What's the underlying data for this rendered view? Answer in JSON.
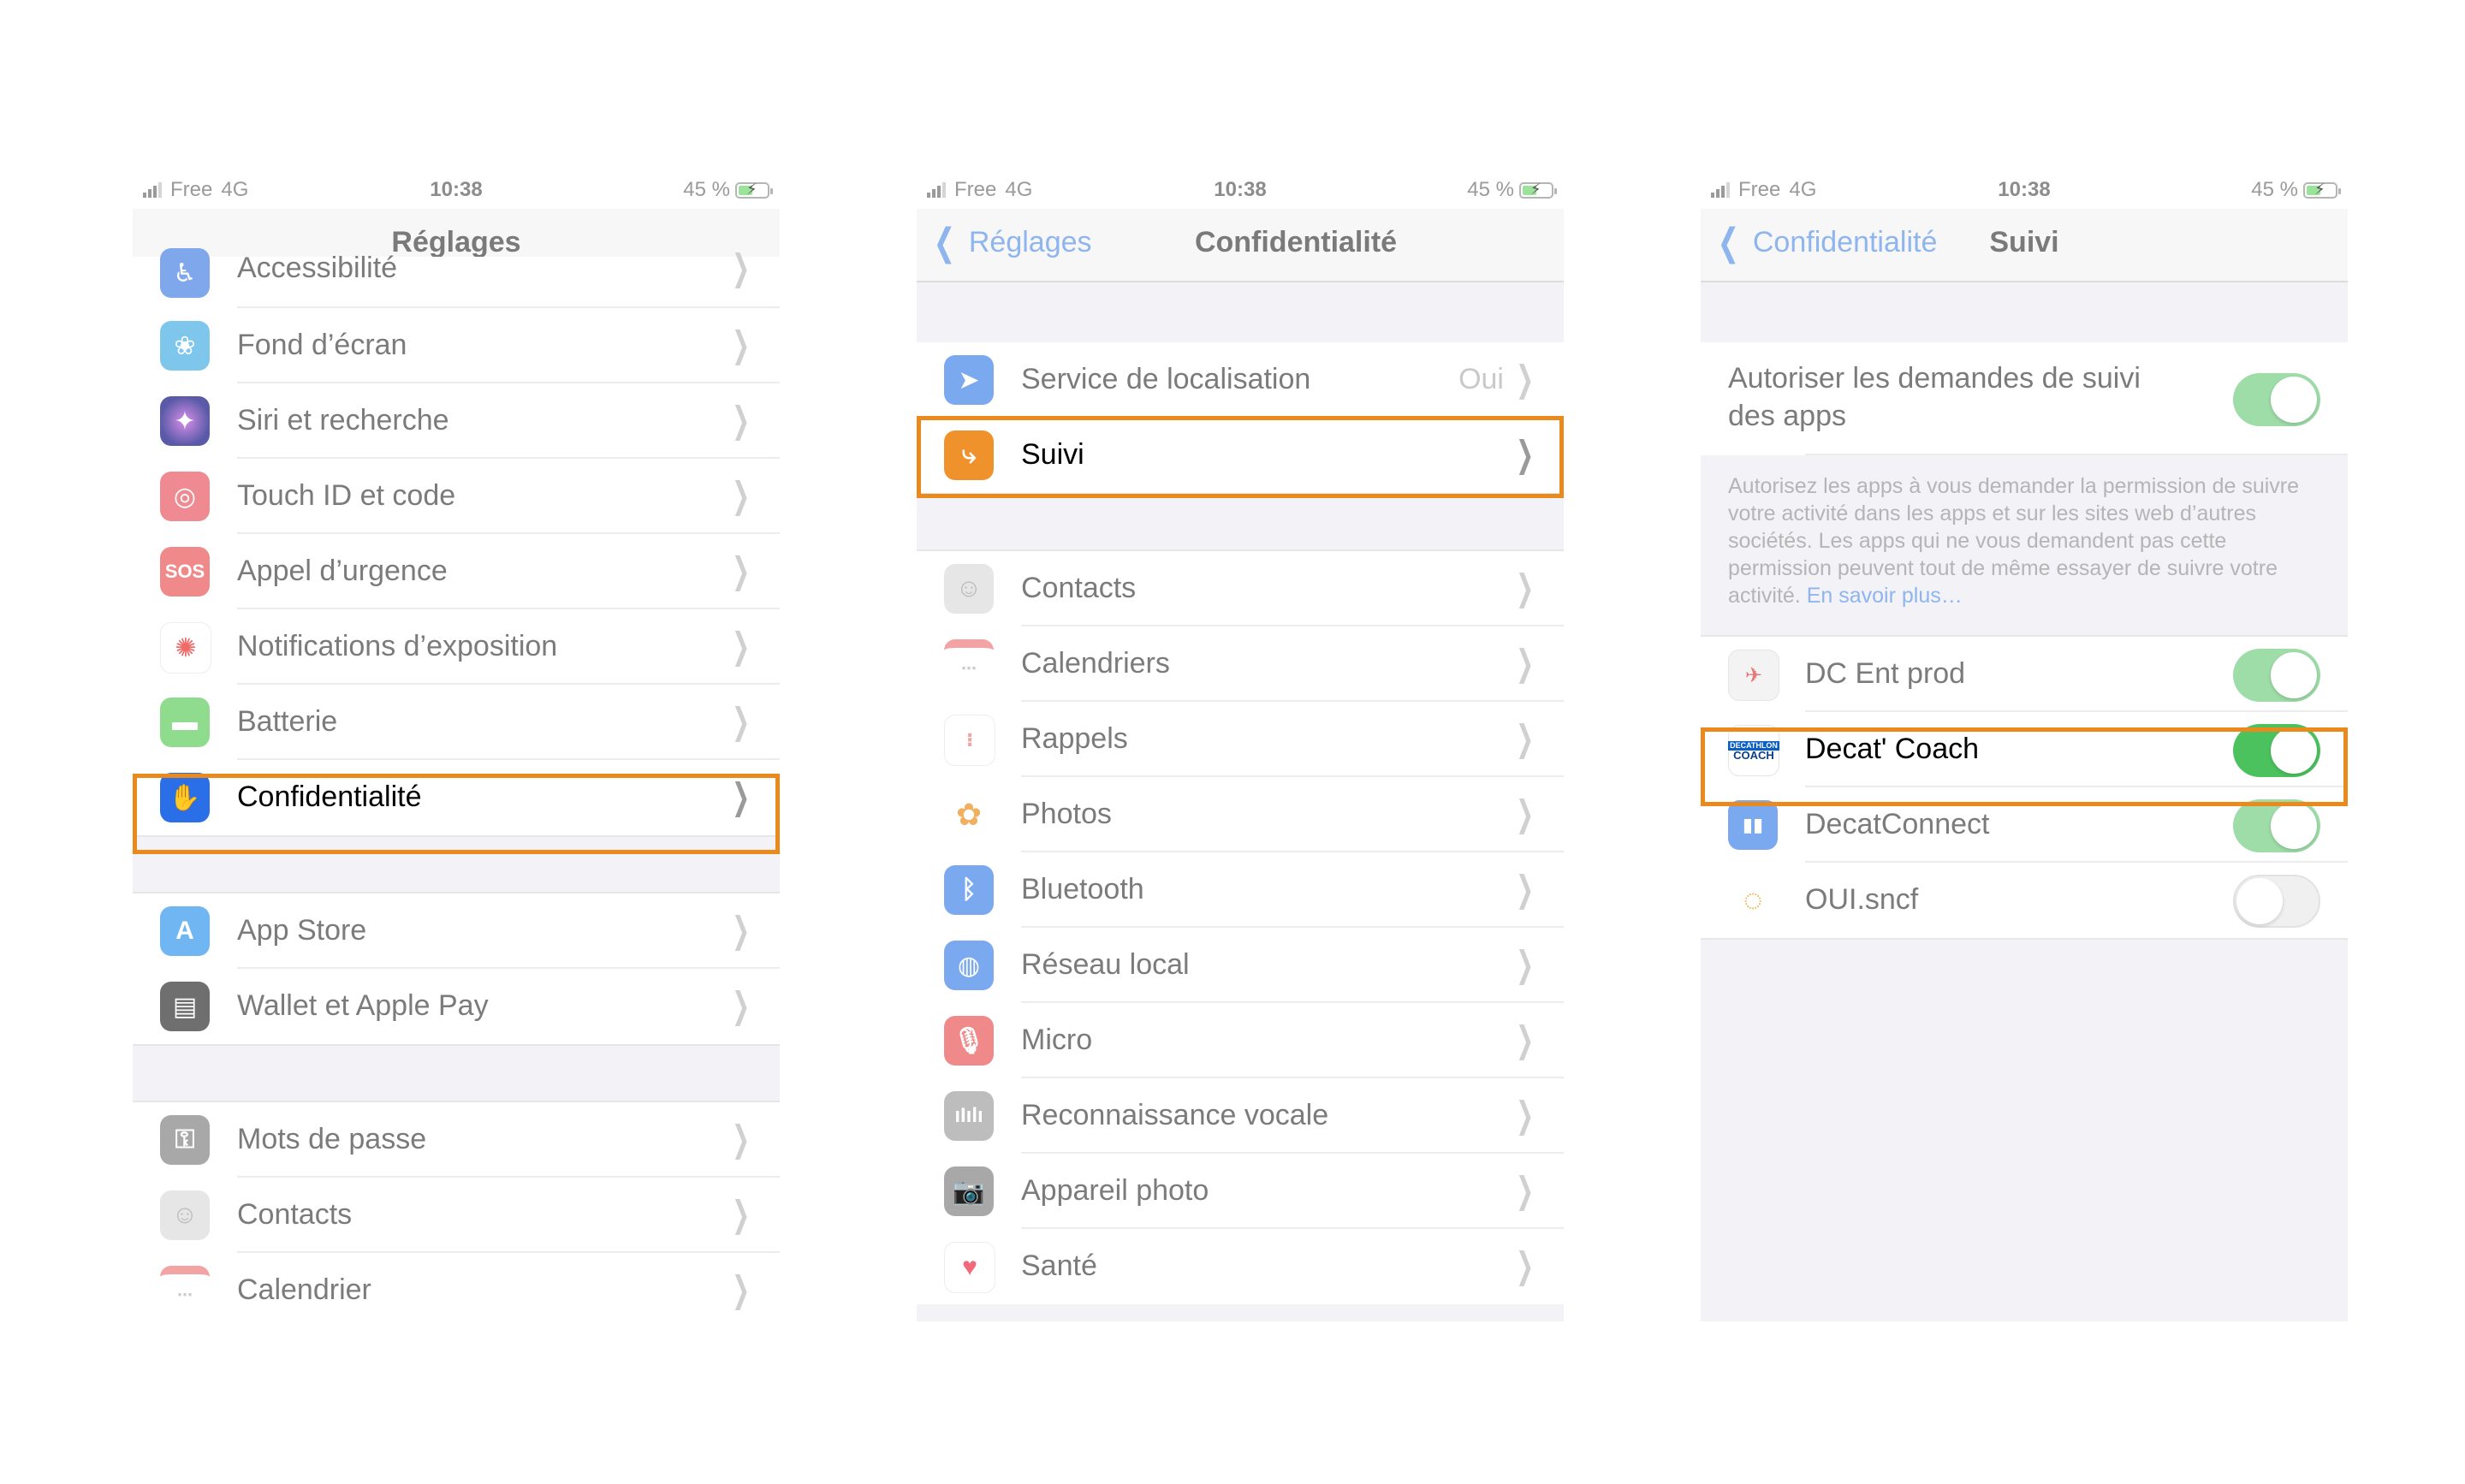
{
  "status": {
    "carrier": "Free",
    "network": "4G",
    "time": "10:38",
    "battery": "45 %"
  },
  "screen1": {
    "title": "Réglages",
    "items": [
      {
        "label": "Accessibilité",
        "icon": "accessibility-icon"
      },
      {
        "label": "Fond d’écran",
        "icon": "wallpaper-icon"
      },
      {
        "label": "Siri et recherche",
        "icon": "siri-icon"
      },
      {
        "label": "Touch ID et code",
        "icon": "fingerprint-icon"
      },
      {
        "label": "Appel d’urgence",
        "icon": "sos-icon",
        "icon_text": "SOS"
      },
      {
        "label": "Notifications d’exposition",
        "icon": "exposure-icon"
      },
      {
        "label": "Batterie",
        "icon": "battery-icon"
      },
      {
        "label": "Confidentialité",
        "icon": "hand-icon"
      },
      {
        "label": "App Store",
        "icon": "app-store-icon"
      },
      {
        "label": "Wallet et Apple Pay",
        "icon": "wallet-icon"
      },
      {
        "label": "Mots de passe",
        "icon": "key-icon"
      },
      {
        "label": "Contacts",
        "icon": "contacts-icon"
      },
      {
        "label": "Calendrier",
        "icon": "calendar-icon"
      }
    ]
  },
  "screen2": {
    "back": "Réglages",
    "title": "Confidentialité",
    "location": {
      "label": "Service de localisation",
      "value": "Oui"
    },
    "tracking": {
      "label": "Suivi"
    },
    "items": [
      {
        "label": "Contacts",
        "icon": "contacts-icon"
      },
      {
        "label": "Calendriers",
        "icon": "calendar-icon"
      },
      {
        "label": "Rappels",
        "icon": "reminders-icon"
      },
      {
        "label": "Photos",
        "icon": "photos-icon"
      },
      {
        "label": "Bluetooth",
        "icon": "bluetooth-icon"
      },
      {
        "label": "Réseau local",
        "icon": "globe-icon"
      },
      {
        "label": "Micro",
        "icon": "microphone-icon"
      },
      {
        "label": "Reconnaissance vocale",
        "icon": "waveform-icon"
      },
      {
        "label": "Appareil photo",
        "icon": "camera-icon"
      },
      {
        "label": "Santé",
        "icon": "heart-icon"
      }
    ]
  },
  "screen3": {
    "back": "Confidentialité",
    "title": "Suivi",
    "allow": {
      "label_line1": "Autoriser les demandes de suivi",
      "label_line2": "des apps",
      "on": true
    },
    "footer": "Autorisez les apps à vous demander la permission de suivre votre activité dans les apps et sur les sites web d’autres sociétés. Les apps qui ne vous demandent pas cette permission peuvent tout de même essayer de suivre votre activité.",
    "footer_link": "En savoir plus…",
    "apps": [
      {
        "label": "DC Ent prod",
        "on": true
      },
      {
        "label": "Decat' Coach",
        "on": true
      },
      {
        "label": "DecatConnect",
        "on": true
      },
      {
        "label": "OUI.sncf",
        "on": false
      }
    ],
    "decathlon_logo_text": "DECATHLON",
    "coach_logo_text": "COACH"
  },
  "colors": {
    "highlight": "#ea8a1c",
    "link": "#8fb5ee",
    "toggle_on": "#4cc25f"
  }
}
